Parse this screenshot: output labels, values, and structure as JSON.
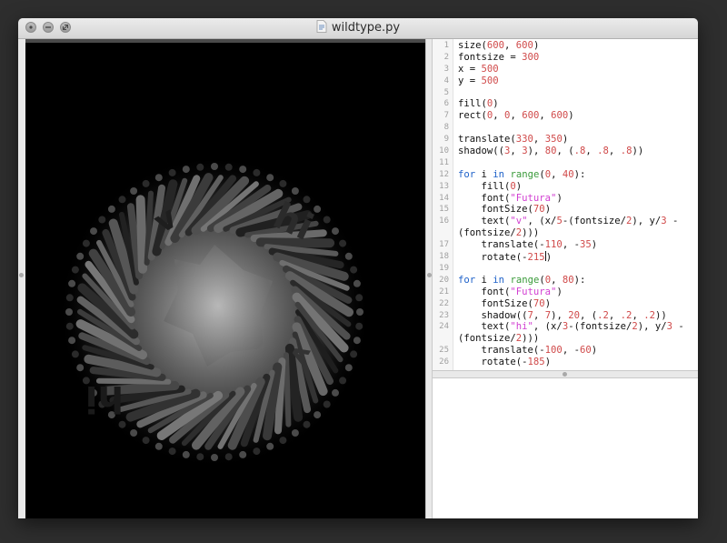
{
  "window": {
    "title": "wildtype.py",
    "controls": [
      "close",
      "minimize",
      "zoom"
    ]
  },
  "canvas": {
    "art_text_v": "v",
    "art_text_hi": "hi",
    "background_color": "#000000"
  },
  "editor": {
    "lines": [
      {
        "n": "1",
        "t": [
          [
            "p",
            "size("
          ],
          [
            "n",
            "600"
          ],
          [
            "p",
            ", "
          ],
          [
            "n",
            "600"
          ],
          [
            "p",
            ")"
          ]
        ]
      },
      {
        "n": "2",
        "t": [
          [
            "p",
            "fontsize = "
          ],
          [
            "n",
            "300"
          ]
        ]
      },
      {
        "n": "3",
        "t": [
          [
            "p",
            "x = "
          ],
          [
            "n",
            "500"
          ]
        ]
      },
      {
        "n": "4",
        "t": [
          [
            "p",
            "y = "
          ],
          [
            "n",
            "500"
          ]
        ]
      },
      {
        "n": "5",
        "t": []
      },
      {
        "n": "6",
        "t": [
          [
            "p",
            "fill("
          ],
          [
            "n",
            "0"
          ],
          [
            "p",
            ")"
          ]
        ]
      },
      {
        "n": "7",
        "t": [
          [
            "p",
            "rect("
          ],
          [
            "n",
            "0"
          ],
          [
            "p",
            ", "
          ],
          [
            "n",
            "0"
          ],
          [
            "p",
            ", "
          ],
          [
            "n",
            "600"
          ],
          [
            "p",
            ", "
          ],
          [
            "n",
            "600"
          ],
          [
            "p",
            ")"
          ]
        ]
      },
      {
        "n": "8",
        "t": []
      },
      {
        "n": "9",
        "t": [
          [
            "p",
            "translate("
          ],
          [
            "n",
            "330"
          ],
          [
            "p",
            ", "
          ],
          [
            "n",
            "350"
          ],
          [
            "p",
            ")"
          ]
        ]
      },
      {
        "n": "10",
        "t": [
          [
            "p",
            "shadow(("
          ],
          [
            "n",
            "3"
          ],
          [
            "p",
            ", "
          ],
          [
            "n",
            "3"
          ],
          [
            "p",
            "), "
          ],
          [
            "n",
            "80"
          ],
          [
            "p",
            ", ("
          ],
          [
            "n",
            ".8"
          ],
          [
            "p",
            ", "
          ],
          [
            "n",
            ".8"
          ],
          [
            "p",
            ", "
          ],
          [
            "n",
            ".8"
          ],
          [
            "p",
            "))"
          ]
        ]
      },
      {
        "n": "11",
        "t": []
      },
      {
        "n": "12",
        "t": [
          [
            "k",
            "for"
          ],
          [
            "p",
            " i "
          ],
          [
            "k",
            "in"
          ],
          [
            "p",
            " "
          ],
          [
            "b",
            "range"
          ],
          [
            "p",
            "("
          ],
          [
            "n",
            "0"
          ],
          [
            "p",
            ", "
          ],
          [
            "n",
            "40"
          ],
          [
            "p",
            "):"
          ]
        ]
      },
      {
        "n": "13",
        "t": [
          [
            "p",
            "    fill("
          ],
          [
            "n",
            "0"
          ],
          [
            "p",
            ")"
          ]
        ]
      },
      {
        "n": "14",
        "t": [
          [
            "p",
            "    font("
          ],
          [
            "s",
            "\"Futura\""
          ],
          [
            "p",
            ")"
          ]
        ]
      },
      {
        "n": "15",
        "t": [
          [
            "p",
            "    fontSize("
          ],
          [
            "n",
            "70"
          ],
          [
            "p",
            ")"
          ]
        ]
      },
      {
        "n": "16",
        "t": [
          [
            "p",
            "    text("
          ],
          [
            "s",
            "\"v\""
          ],
          [
            "p",
            ", (x/"
          ],
          [
            "n",
            "5"
          ],
          [
            "p",
            "-(fontsize/"
          ],
          [
            "n",
            "2"
          ],
          [
            "p",
            "), y/"
          ],
          [
            "n",
            "3"
          ],
          [
            "p",
            " -"
          ]
        ],
        "c": [
          [
            "p",
            "(fontsize/"
          ],
          [
            "n",
            "2"
          ],
          [
            "p",
            ")))"
          ]
        ]
      },
      {
        "n": "17",
        "t": [
          [
            "p",
            "    translate(-"
          ],
          [
            "n",
            "110"
          ],
          [
            "p",
            ", -"
          ],
          [
            "n",
            "35"
          ],
          [
            "p",
            ")"
          ]
        ]
      },
      {
        "n": "18",
        "t": [
          [
            "p",
            "    rotate(-"
          ],
          [
            "n",
            "215"
          ],
          [
            "c",
            ""
          ],
          [
            "p",
            ")"
          ]
        ]
      },
      {
        "n": "19",
        "t": []
      },
      {
        "n": "20",
        "t": [
          [
            "k",
            "for"
          ],
          [
            "p",
            " i "
          ],
          [
            "k",
            "in"
          ],
          [
            "p",
            " "
          ],
          [
            "b",
            "range"
          ],
          [
            "p",
            "("
          ],
          [
            "n",
            "0"
          ],
          [
            "p",
            ", "
          ],
          [
            "n",
            "80"
          ],
          [
            "p",
            "):"
          ]
        ]
      },
      {
        "n": "21",
        "t": [
          [
            "p",
            "    font("
          ],
          [
            "s",
            "\"Futura\""
          ],
          [
            "p",
            ")"
          ]
        ]
      },
      {
        "n": "22",
        "t": [
          [
            "p",
            "    fontSize("
          ],
          [
            "n",
            "70"
          ],
          [
            "p",
            ")"
          ]
        ]
      },
      {
        "n": "23",
        "t": [
          [
            "p",
            "    shadow(("
          ],
          [
            "n",
            "7"
          ],
          [
            "p",
            ", "
          ],
          [
            "n",
            "7"
          ],
          [
            "p",
            "), "
          ],
          [
            "n",
            "20"
          ],
          [
            "p",
            ", ("
          ],
          [
            "n",
            ".2"
          ],
          [
            "p",
            ", "
          ],
          [
            "n",
            ".2"
          ],
          [
            "p",
            ", "
          ],
          [
            "n",
            ".2"
          ],
          [
            "p",
            "))"
          ]
        ]
      },
      {
        "n": "24",
        "t": [
          [
            "p",
            "    text("
          ],
          [
            "s",
            "\"hi\""
          ],
          [
            "p",
            ", (x/"
          ],
          [
            "n",
            "3"
          ],
          [
            "p",
            "-(fontsize/"
          ],
          [
            "n",
            "2"
          ],
          [
            "p",
            "), y/"
          ],
          [
            "n",
            "3"
          ],
          [
            "p",
            " -"
          ]
        ],
        "c": [
          [
            "p",
            "(fontsize/"
          ],
          [
            "n",
            "2"
          ],
          [
            "p",
            ")))"
          ]
        ]
      },
      {
        "n": "25",
        "t": [
          [
            "p",
            "    translate(-"
          ],
          [
            "n",
            "100"
          ],
          [
            "p",
            ", -"
          ],
          [
            "n",
            "60"
          ],
          [
            "p",
            ")"
          ]
        ]
      },
      {
        "n": "26",
        "t": [
          [
            "p",
            "    rotate(-"
          ],
          [
            "n",
            "185"
          ],
          [
            "p",
            ")"
          ]
        ]
      }
    ]
  },
  "output": {
    "text": ""
  }
}
